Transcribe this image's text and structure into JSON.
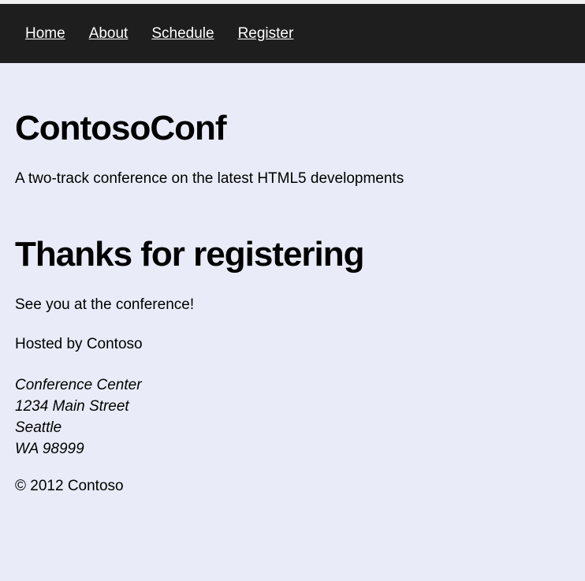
{
  "nav": {
    "items": [
      "Home",
      "About",
      "Schedule",
      "Register"
    ]
  },
  "header": {
    "title": "ContosoConf",
    "tagline": "A two-track conference on the latest HTML5 developments"
  },
  "main": {
    "heading": "Thanks for registering",
    "message": "See you at the conference!"
  },
  "footer": {
    "hosted": "Hosted by Contoso",
    "address": [
      "Conference Center",
      "1234 Main Street",
      "Seattle",
      "WA 98999"
    ],
    "copyright": "© 2012 Contoso"
  }
}
